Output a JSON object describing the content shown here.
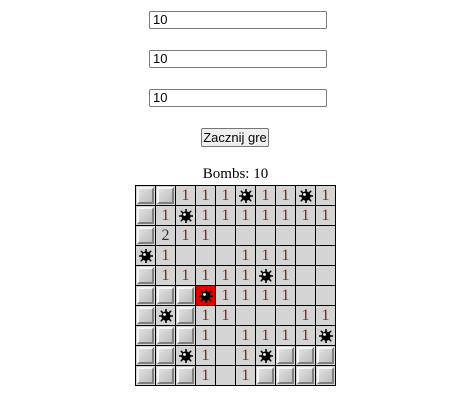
{
  "inputs": {
    "rows": "10",
    "cols": "10",
    "bombs": "10"
  },
  "start_button_label": "Zacznij gre",
  "bombs_counter": "Bombs: 10",
  "board": [
    [
      "H",
      "H",
      "1",
      "1",
      "1",
      "M",
      "1",
      "1",
      "M",
      "1"
    ],
    [
      "H",
      "1",
      "M",
      "1",
      "1",
      "1",
      "1",
      "1",
      "1",
      "1"
    ],
    [
      "H",
      "2",
      "1",
      "1",
      "E",
      "E",
      "E",
      "E",
      "E",
      "E"
    ],
    [
      "M",
      "1",
      "E",
      "E",
      "E",
      "1",
      "1",
      "1",
      "E",
      "E"
    ],
    [
      "H",
      "1",
      "1",
      "1",
      "1",
      "1",
      "M",
      "1",
      "E",
      "E"
    ],
    [
      "H",
      "H",
      "H",
      "X",
      "1",
      "1",
      "1",
      "1",
      "E",
      "E"
    ],
    [
      "H",
      "M",
      "H",
      "1",
      "1",
      "E",
      "E",
      "E",
      "1",
      "1"
    ],
    [
      "H",
      "H",
      "H",
      "1",
      "E",
      "1",
      "1",
      "1",
      "1",
      "M"
    ],
    [
      "H",
      "H",
      "M",
      "1",
      "E",
      "1",
      "M",
      "H",
      "H",
      "H"
    ],
    [
      "H",
      "H",
      "H",
      "1",
      "E",
      "1",
      "H",
      "H",
      "H",
      "H"
    ]
  ],
  "colors": {
    "exploded_cell": "#e00000",
    "number": "#7a2a10",
    "revealed_cell": "#d4d4d4"
  }
}
